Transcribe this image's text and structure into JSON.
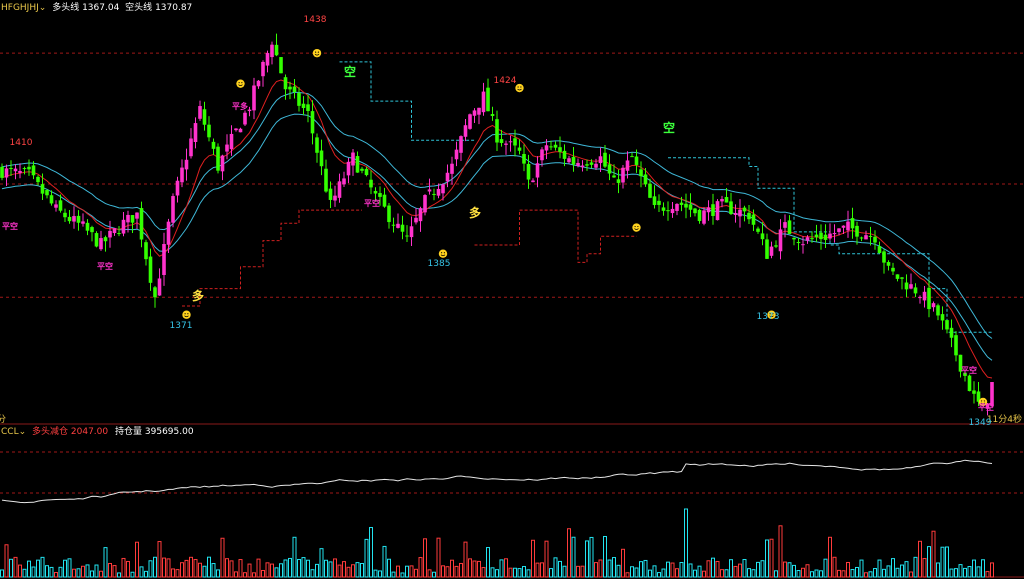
{
  "header": {
    "symbol": "HFGHJHJ",
    "long_label": "多头线",
    "long_value": "1367.04",
    "short_label": "空头线",
    "short_value": "1370.87"
  },
  "lower_header": {
    "indicator": "CCL",
    "long_add_label": "多头减仓",
    "long_add_value": "2047.00",
    "open_interest_label": "持仓量",
    "open_interest_value": "395695.00"
  },
  "timeframe_label": "分",
  "countdown_label": "11分4秒",
  "colors": {
    "bull": "#ff33cc",
    "bear": "#33ff00",
    "band": "#3fb8d8",
    "fast_ma": "#e02020",
    "stop_line": "#2fc4d8",
    "ref_line": "#a01818",
    "vol_up": "#ff3b3b",
    "vol_down": "#22e4f0",
    "oi_line": "#e6e6e6"
  },
  "chart_data": {
    "type": "candlestick",
    "price_labels": [
      {
        "text": "1438",
        "kind": "high"
      },
      {
        "text": "1424",
        "kind": "high"
      },
      {
        "text": "1410",
        "kind": "high"
      },
      {
        "text": "1371",
        "kind": "low"
      },
      {
        "text": "1385",
        "kind": "low"
      },
      {
        "text": "1373",
        "kind": "low"
      },
      {
        "text": "1349",
        "kind": "low"
      }
    ],
    "signals": [
      {
        "text": "多",
        "kind": "long"
      },
      {
        "text": "多",
        "kind": "long"
      },
      {
        "text": "空",
        "kind": "short"
      },
      {
        "text": "空",
        "kind": "short"
      },
      {
        "text": "平空",
        "kind": "close"
      },
      {
        "text": "平空",
        "kind": "close"
      },
      {
        "text": "平多",
        "kind": "close"
      },
      {
        "text": "平空",
        "kind": "close"
      },
      {
        "text": "平空",
        "kind": "close"
      },
      {
        "text": "平空",
        "kind": "close"
      }
    ],
    "reference_levels": [
      1432,
      1376,
      1402
    ],
    "series": [
      {
        "name": "多头线",
        "value": 1367.04
      },
      {
        "name": "空头线",
        "value": 1370.87
      }
    ],
    "open_interest": {
      "name": "持仓量",
      "last": 395695.0
    }
  }
}
